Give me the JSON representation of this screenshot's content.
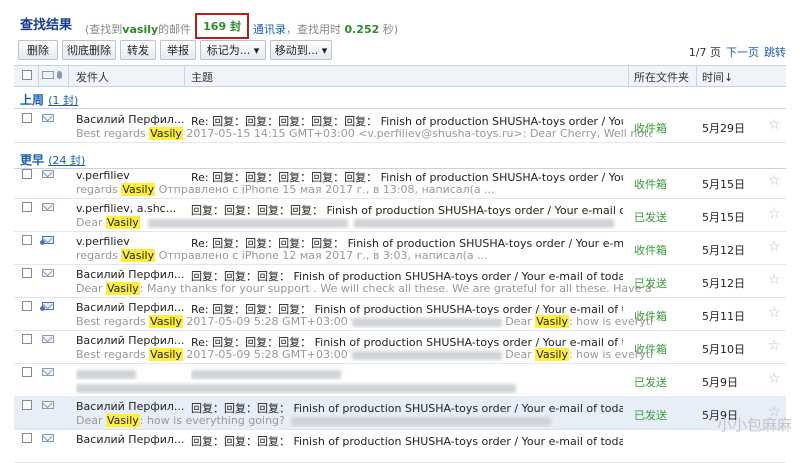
{
  "header": {
    "title": "查找结果",
    "prefix": "(查找到",
    "keyword": "vasily",
    "mid": "的邮件",
    "count": "169 封",
    "contacts_link": "通讯录",
    "time_prefix": "，查找用时",
    "time": "0.252",
    "time_suffix": "秒)"
  },
  "toolbar": {
    "delete": "删除",
    "delete_after_read": "彻底删除",
    "forward": "转发",
    "report": "举报",
    "mark_as": "标记为...",
    "move_to": "移动到...",
    "page": "1/7 页",
    "next_page": "下一页",
    "jump": "跳转"
  },
  "columns": {
    "sender": "发件人",
    "subject": "主题",
    "folder": "所在文件夹",
    "time": "时间↓"
  },
  "groups": {
    "last_week": {
      "label": "上周",
      "count": "(1 封)"
    },
    "earlier": {
      "label": "更早",
      "count": "(24 封)"
    }
  },
  "rows": [
    {
      "sender": "Василий Перфил...",
      "subject": "Re: 回复：回复：回复：回复：回复： Finish of production SHUSHA-toys order / Your e-ma...",
      "preview_a": "Best regards ",
      "preview_hl": "Vasily",
      "preview_b": " 2017-05-15 14:15 GMT+03:00 <v.perfiliev@shusha-toys.ru>: Dear Cherry, Well noted, thanks! Best ...",
      "folder": "收件箱",
      "date": "5月29日"
    },
    {
      "sender": "v.perfiliev",
      "subject": "Re: 回复：回复：回复：回复：回复： Finish of production SHUSHA-toys order / Your e-ma...",
      "preview_a": "regards ",
      "preview_hl": "Vasily",
      "preview_b": " Отправлено с iPhone 15 мая 2017 г., в 13:08,               написал(а ...",
      "folder": "收件箱",
      "date": "5月15日"
    },
    {
      "sender": "v.perfiliev,  a.shc...",
      "subject": "回复：回复：回复：回复： Finish of production SHUSHA-toys order / Your e-mail of...",
      "preview_a": "Dear ",
      "preview_hl": "Vasily",
      "preview_b": "",
      "folder": "已发送",
      "date": "5月15日"
    },
    {
      "sender": "v.perfiliev",
      "subject": "Re: 回复：回复：回复：回复： Finish of production SHUSHA-toys order / Your e-mail of to...",
      "preview_a": "regards ",
      "preview_hl": "Vasily",
      "preview_b": " Отправлено с iPhone 12 мая 2017 г., в 3:03,               написал(а ...",
      "folder": "收件箱",
      "date": "5月12日"
    },
    {
      "sender": "Василий Перфил...",
      "subject": "回复：回复：回复： Finish of production SHUSHA-toys order / Your e-mail of today.",
      "preview_a": "Dear ",
      "preview_hl": "Vasily",
      "preview_b": ": Many thanks for your support . We will check all these. We are grateful for all these. Have a nice day. Cherry ...",
      "folder": "已发送",
      "date": "5月12日"
    },
    {
      "sender": "Василий Перфил...",
      "subject": "Re: 回复：回复：回复： Finish of production SHUSHA-toys order / Your e-mail of today.",
      "preview_a": "Best regards ",
      "preview_hl": "Vasily",
      "preview_b": " 2017-05-09 5:28 GMT+03:00",
      "preview_c": " Dear ",
      "preview_hl2": "Vasily",
      "preview_d": ": how is everything going? Our editor ...",
      "folder": "收件箱",
      "date": "5月11日"
    },
    {
      "sender": "Василий Перфил...",
      "subject": "Re: 回复：回复：回复： Finish of production SHUSHA-toys order / Your e-mail of today.",
      "preview_a": "Best regards ",
      "preview_hl": "Vasily",
      "preview_b": " 2017-05-09 5:28 GMT+03:00",
      "preview_c": " Dear ",
      "preview_hl2": "Vasily",
      "preview_d": ": how is everything going? Our editor ...",
      "folder": "收件箱",
      "date": "5月10日"
    },
    {
      "sender": "",
      "subject": "",
      "preview_a": "",
      "preview_hl": "",
      "preview_b": "",
      "folder": "已发送",
      "date": "5月9日"
    },
    {
      "sender": "Василий Перфил...",
      "subject": "回复：回复：回复： Finish of production SHUSHA-toys order / Your e-mail of today.",
      "preview_a": "Dear ",
      "preview_hl": "Vasily",
      "preview_b": ": how is everything going?",
      "folder": "已发送",
      "date": "5月9日"
    },
    {
      "sender": "Василий Перфил...",
      "subject": "回复：回复：回复： Finish of production SHUSHA-toys order / Your e-mail of today.",
      "preview_a": "",
      "preview_hl": "",
      "preview_b": "",
      "folder": "",
      "date": ""
    }
  ],
  "watermark": "小小包麻麻"
}
